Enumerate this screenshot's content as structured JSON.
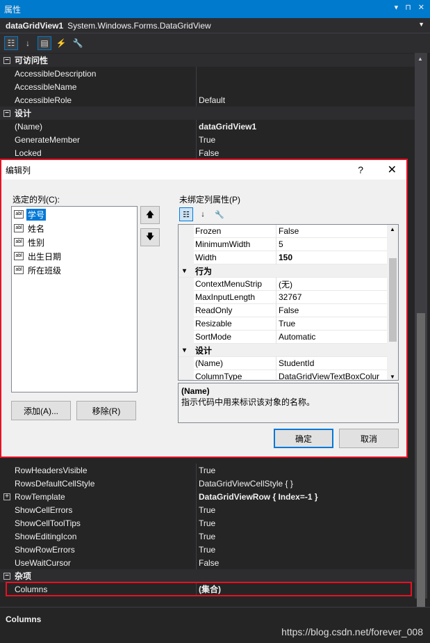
{
  "window": {
    "title": "属性",
    "object_name": "dataGridView1",
    "object_type": "System.Windows.Forms.DataGridView"
  },
  "grid_rows": [
    {
      "kind": "cat",
      "name": "可访问性"
    },
    {
      "kind": "prop",
      "name": "AccessibleDescription",
      "value": ""
    },
    {
      "kind": "prop",
      "name": "AccessibleName",
      "value": ""
    },
    {
      "kind": "prop",
      "name": "AccessibleRole",
      "value": "Default"
    },
    {
      "kind": "cat",
      "name": "设计"
    },
    {
      "kind": "prop",
      "name": "(Name)",
      "value": "dataGridView1",
      "bold": true
    },
    {
      "kind": "prop",
      "name": "GenerateMember",
      "value": "True"
    },
    {
      "kind": "prop",
      "name": "Locked",
      "value": "False"
    }
  ],
  "grid_rows_bottom": [
    {
      "kind": "prop",
      "name": "RowHeadersVisible",
      "value": "True"
    },
    {
      "kind": "prop",
      "name": "RowsDefaultCellStyle",
      "value": "DataGridViewCellStyle { }"
    },
    {
      "kind": "prop",
      "name": "RowTemplate",
      "value": "DataGridViewRow { Index=-1 }",
      "bold": true,
      "expand": true
    },
    {
      "kind": "prop",
      "name": "ShowCellErrors",
      "value": "True"
    },
    {
      "kind": "prop",
      "name": "ShowCellToolTips",
      "value": "True"
    },
    {
      "kind": "prop",
      "name": "ShowEditingIcon",
      "value": "True"
    },
    {
      "kind": "prop",
      "name": "ShowRowErrors",
      "value": "True"
    },
    {
      "kind": "prop",
      "name": "UseWaitCursor",
      "value": "False"
    },
    {
      "kind": "cat",
      "name": "杂项"
    },
    {
      "kind": "prop",
      "name": "Columns",
      "value": "(集合)",
      "bold": true
    }
  ],
  "description": {
    "title": "Columns"
  },
  "watermark": "https://blog.csdn.net/forever_008",
  "dialog": {
    "title": "编辑列",
    "help": "?",
    "selected_label": "选定的列(C):",
    "columns": [
      "学号",
      "姓名",
      "性别",
      "出生日期",
      "所在班级"
    ],
    "selected_index": 0,
    "props_label": "未绑定列属性(P)",
    "add_button": "添加(A)...",
    "remove_button": "移除(R)",
    "ok_button": "确定",
    "cancel_button": "取消",
    "props": [
      {
        "kind": "prop",
        "name": "Frozen",
        "value": "False"
      },
      {
        "kind": "prop",
        "name": "MinimumWidth",
        "value": "5"
      },
      {
        "kind": "prop",
        "name": "Width",
        "value": "150",
        "bold": true
      },
      {
        "kind": "cat",
        "name": "行为"
      },
      {
        "kind": "prop",
        "name": "ContextMenuStrip",
        "value": "(无)"
      },
      {
        "kind": "prop",
        "name": "MaxInputLength",
        "value": "32767"
      },
      {
        "kind": "prop",
        "name": "ReadOnly",
        "value": "False"
      },
      {
        "kind": "prop",
        "name": "Resizable",
        "value": "True"
      },
      {
        "kind": "prop",
        "name": "SortMode",
        "value": "Automatic"
      },
      {
        "kind": "cat",
        "name": "设计"
      },
      {
        "kind": "prop",
        "name": "(Name)",
        "value": "StudentId"
      },
      {
        "kind": "prop",
        "name": "ColumnType",
        "value": "DataGridViewTextBoxColur"
      }
    ],
    "desc_title": "(Name)",
    "desc_text": "指示代码中用来标识该对象的名称。"
  },
  "colors": {
    "accent": "#007acc",
    "highlight": "#e81123",
    "background": "#252526"
  }
}
